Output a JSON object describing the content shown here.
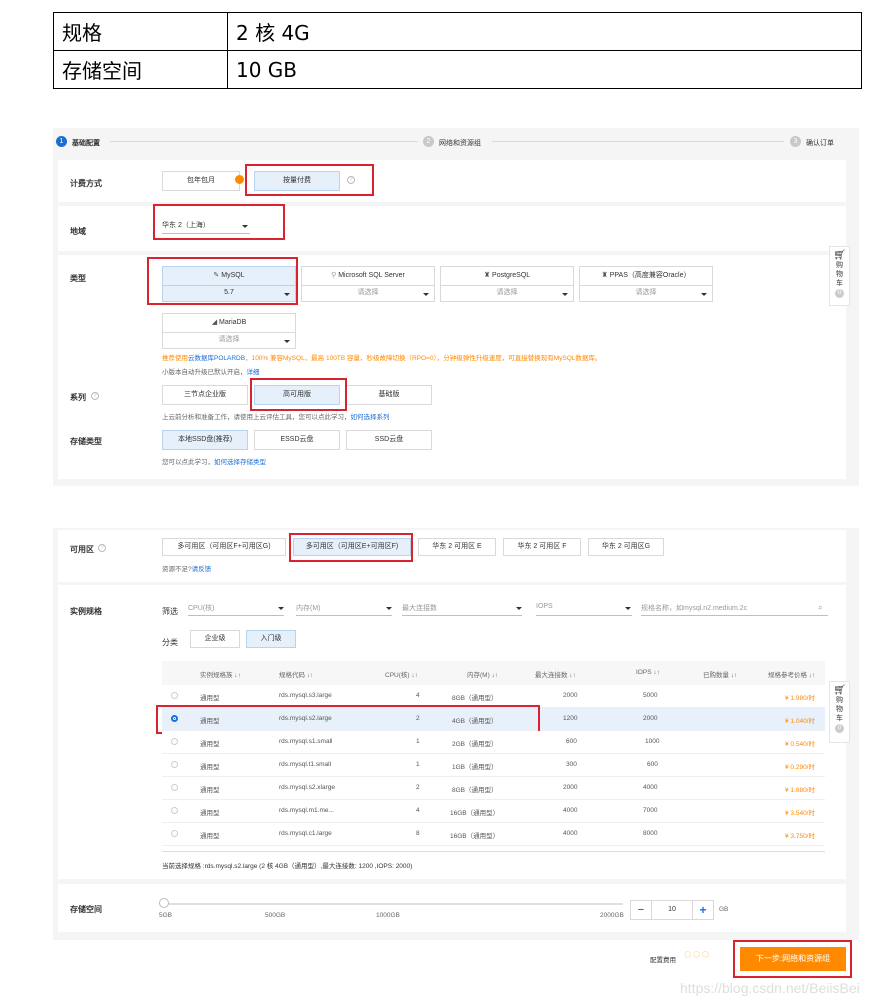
{
  "spec_table": {
    "rows": [
      {
        "key": "规格",
        "value": "2 核 4G"
      },
      {
        "key": "存储空间",
        "value": "10 GB"
      }
    ]
  },
  "steps": [
    {
      "num": "1",
      "label": "基础配置",
      "active": true
    },
    {
      "num": "2",
      "label": "网络和资源组",
      "active": false
    },
    {
      "num": "3",
      "label": "确认订单",
      "active": false
    }
  ],
  "billing": {
    "label": "计费方式",
    "options": [
      "包年包月",
      "按量付费"
    ],
    "selected": "按量付费"
  },
  "region": {
    "label": "地域",
    "value": "华东 2（上海）"
  },
  "engine": {
    "label": "类型",
    "types": [
      {
        "name": "MySQL",
        "version": "5.7"
      },
      {
        "name": "Microsoft SQL Server",
        "version": "请选择"
      },
      {
        "name": "PostgreSQL",
        "version": "请选择"
      },
      {
        "name": "PPAS（高度兼容Oracle）",
        "version": "请选择"
      },
      {
        "name": "MariaDB",
        "version": "请选择"
      }
    ],
    "notice_prefix": "推荐使用",
    "notice_link": "云数据库POLARDB",
    "notice_rest": "，100% 兼容MySQL，最高 100TB 容量，秒级故障切换（RPO=0），分钟级弹性升级速度，可直接替换现有MySQL数据库。",
    "minor_version": "小版本自动升级已默认开启，",
    "minor_link": "详细"
  },
  "series": {
    "label": "系列",
    "options": [
      "三节点企业版",
      "高可用版",
      "基础版"
    ],
    "selected": "高可用版",
    "hint_prefix": "上云前分析和准备工作，请使用上云评估工具，您可以点此学习，",
    "hint_link": "如何选择系列"
  },
  "storage_type": {
    "label": "存储类型",
    "options": [
      "本地SSD盘(推荐)",
      "ESSD云盘",
      "SSD云盘"
    ],
    "selected": "本地SSD盘(推荐)",
    "hint_prefix": "您可以点此学习，",
    "hint_link": "如何选择存储类型"
  },
  "cart": {
    "label": "购物车",
    "count": "0"
  },
  "zone": {
    "label": "可用区",
    "options": [
      "多可用区（可用区F+可用区G)",
      "多可用区（可用区E+可用区F)",
      "华东 2 可用区 E",
      "华东 2 可用区 F",
      "华东 2 可用区G"
    ],
    "selected": "多可用区（可用区E+可用区F)",
    "hint_prefix": "资源不足?",
    "hint_link": "请反馈"
  },
  "instance": {
    "label": "实例规格",
    "filter_label": "筛选",
    "filters": [
      "CPU(核)",
      "内存(M)",
      "最大连接数",
      "IOPS"
    ],
    "search_placeholder": "规格名称，如mysql.n2.medium.2c",
    "category_label": "分类",
    "categories": [
      "企业级",
      "入门级"
    ],
    "category_selected": "入门级",
    "columns": [
      "实例规格族 ↓↑",
      "规格代码 ↓↑",
      "CPU(核) ↓↑",
      "内存(M) ↓↑",
      "最大连接数 ↓↑",
      "IOPS ↓↑",
      "已购数量 ↓↑",
      "规格参考价格 ↓↑"
    ],
    "rows": [
      {
        "family": "通用型",
        "code": "rds.mysql.s3.large",
        "cpu": "4",
        "mem": "8GB（通用型）",
        "conn": "2000",
        "iops": "5000",
        "price": "¥ 1.980/时",
        "selected": false
      },
      {
        "family": "通用型",
        "code": "rds.mysql.s2.large",
        "cpu": "2",
        "mem": "4GB（通用型）",
        "conn": "1200",
        "iops": "2000",
        "price": "¥ 1.040/时",
        "selected": true
      },
      {
        "family": "通用型",
        "code": "rds.mysql.s1.small",
        "cpu": "1",
        "mem": "2GB（通用型）",
        "conn": "600",
        "iops": "1000",
        "price": "¥ 0.540/时",
        "selected": false
      },
      {
        "family": "通用型",
        "code": "rds.mysql.t1.small",
        "cpu": "1",
        "mem": "1GB（通用型）",
        "conn": "300",
        "iops": "600",
        "price": "¥ 0.290/时",
        "selected": false
      },
      {
        "family": "通用型",
        "code": "rds.mysql.s2.xlarge",
        "cpu": "2",
        "mem": "8GB（通用型）",
        "conn": "2000",
        "iops": "4000",
        "price": "¥ 1.880/时",
        "selected": false
      },
      {
        "family": "通用型",
        "code": "rds.mysql.m1.me...",
        "cpu": "4",
        "mem": "16GB（通用型）",
        "conn": "4000",
        "iops": "7000",
        "price": "¥ 3.540/时",
        "selected": false
      },
      {
        "family": "通用型",
        "code": "rds.mysql.c1.large",
        "cpu": "8",
        "mem": "16GB（通用型）",
        "conn": "4000",
        "iops": "8000",
        "price": "¥ 3.750/时",
        "selected": false
      }
    ],
    "current_label": "当前选择规格 :rds.mysql.s2.large (2 核 4GB（通用型）,最大连接数: 1200 ,IOPS: 2000)"
  },
  "storage": {
    "label": "存储空间",
    "ticks": [
      "5GB",
      "500GB",
      "1000GB",
      "2000GB"
    ],
    "value": "10",
    "unit": "GB",
    "minus": "−",
    "plus": "+"
  },
  "footer": {
    "fee_label": "配置费用",
    "next_button": "下一步:网络和资源组"
  },
  "watermark": "https://blog.csdn.net/BeiisBei",
  "colors": {
    "accent": "#1a6fd6",
    "highlight": "#d9232e",
    "orange": "#ff8a00"
  }
}
